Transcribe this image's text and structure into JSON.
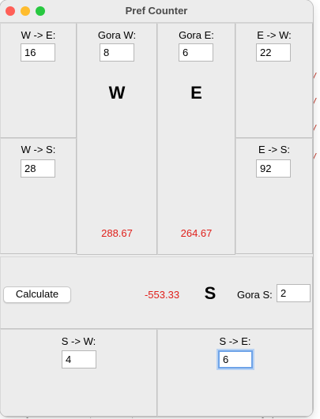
{
  "window": {
    "title": "Pref Counter"
  },
  "we": {
    "label": "W -> E:",
    "value": "16"
  },
  "ws": {
    "label": "W -> S:",
    "value": "28"
  },
  "gora_w": {
    "label": "Gora W:",
    "value": "8",
    "big": "W",
    "result": "288.67"
  },
  "gora_e": {
    "label": "Gora E:",
    "value": "6",
    "big": "E",
    "result": "264.67"
  },
  "ew": {
    "label": "E -> W:",
    "value": "22"
  },
  "es": {
    "label": "E -> S:",
    "value": "92"
  },
  "middle": {
    "calculate_label": "Calculate",
    "result": "-553.33",
    "big": "S",
    "gora_s_label": "Gora S:",
    "gora_s_value": "2"
  },
  "sw": {
    "label": "S -> W:",
    "value": "4"
  },
  "se": {
    "label": "S -> E:",
    "value": "6"
  },
  "colors": {
    "result_red": "#e0201b",
    "focus_blue": "#6ea3e8"
  },
  "background": {
    "bottom_text": "Purty amicr Cnar, Ferrie, ssheral ecook-fu: smorty prere"
  }
}
